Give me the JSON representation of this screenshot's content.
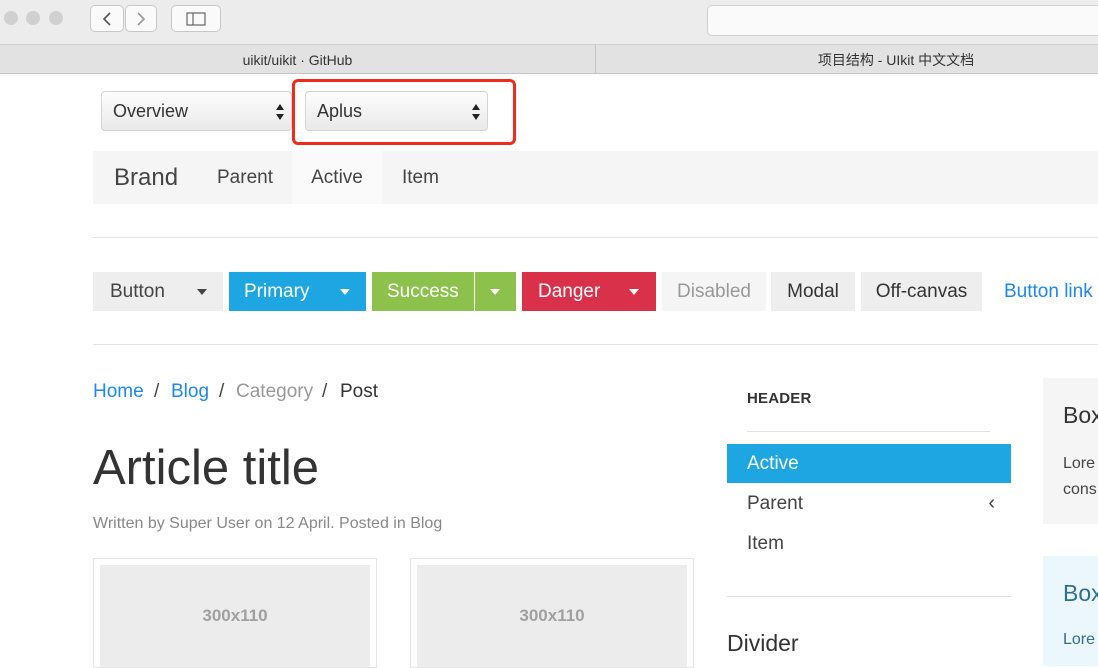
{
  "browser": {
    "tabs": [
      {
        "title": "uikit/uikit · GitHub"
      },
      {
        "title": "项目结构 - UIkit 中文文档"
      }
    ]
  },
  "selects": [
    {
      "value": "Overview"
    },
    {
      "value": "Aplus"
    }
  ],
  "navbar": {
    "brand": "Brand",
    "items": [
      {
        "label": "Parent"
      },
      {
        "label": "Active"
      },
      {
        "label": "Item"
      }
    ]
  },
  "buttons": {
    "button": "Button",
    "primary": "Primary",
    "success": "Success",
    "danger": "Danger",
    "disabled": "Disabled",
    "modal": "Modal",
    "offcanvas": "Off-canvas",
    "link": "Button link"
  },
  "breadcrumb": {
    "home": "Home",
    "blog": "Blog",
    "category": "Category",
    "post": "Post",
    "sep": "/"
  },
  "article": {
    "title": "Article title",
    "meta": "Written by Super User on 12 April. Posted in Blog",
    "thumbs": [
      "300x110",
      "300x110"
    ]
  },
  "sidenav": {
    "header": "HEADER",
    "items": [
      {
        "label": "Active"
      },
      {
        "label": "Parent",
        "chevron": "‹"
      },
      {
        "label": "Item"
      }
    ],
    "divider_heading": "Divider"
  },
  "panels": {
    "box1_title": "Box",
    "box1_text_line1": "Lore",
    "box1_text_line2": "cons",
    "box2_title": "Box",
    "box2_text": "Lore"
  },
  "colors": {
    "primary": "#1ea6e3",
    "success": "#8cc14c",
    "danger": "#da314b",
    "link": "#1e87f0",
    "highlight": "#f02a1c"
  }
}
